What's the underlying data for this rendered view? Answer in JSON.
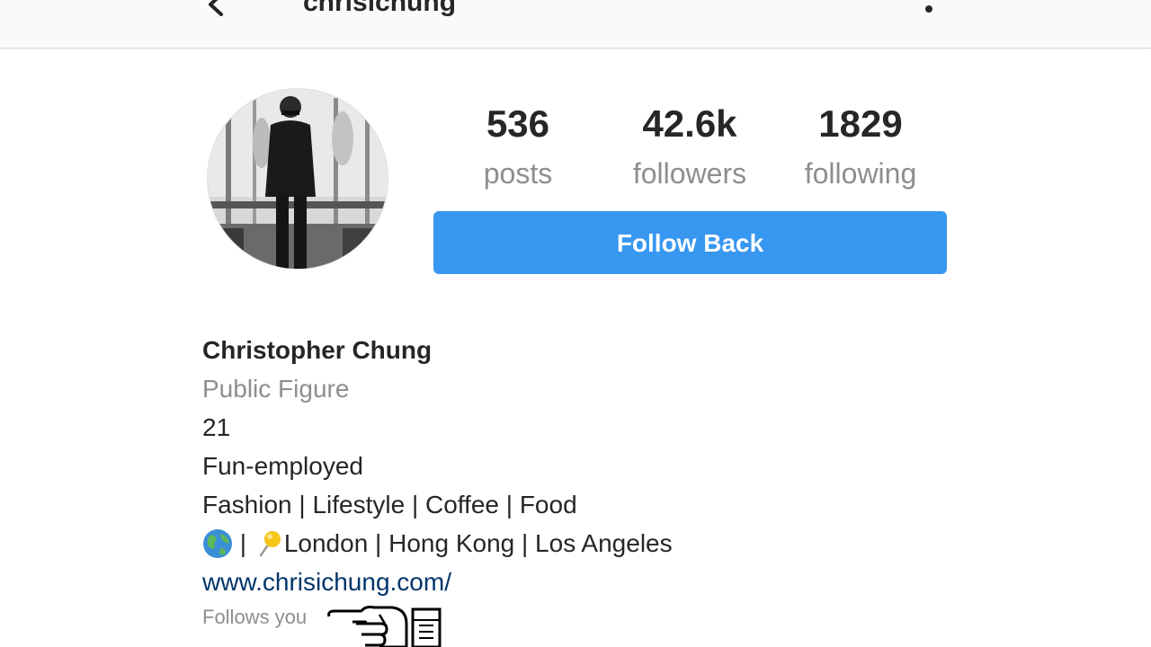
{
  "header": {
    "username": "chrisichung",
    "back_icon": "chevron-left-icon",
    "more_icon": "vertical-dots-icon"
  },
  "profile": {
    "avatar_icon": "profile-photo",
    "stats": [
      {
        "value": "536",
        "label": "posts"
      },
      {
        "value": "42.6k",
        "label": "followers"
      },
      {
        "value": "1829",
        "label": "following"
      }
    ],
    "follow_button_label": "Follow Back",
    "follow_button_color": "#3897f0"
  },
  "bio": {
    "name": "Christopher Chung",
    "category": "Public Figure",
    "line1": "21",
    "line2": "Fun-employed",
    "line3": "Fashion | Lifestyle | Coffee | Food",
    "location_separator": " | ",
    "location_text": "London | Hong Kong | Los Angeles",
    "website": "www.chrisichung.com/",
    "follows_you": "Follows you"
  },
  "colors": {
    "primary_text": "#262626",
    "secondary_text": "#8e8e8e",
    "link": "#003569",
    "topbar_bg": "#fafafa"
  }
}
